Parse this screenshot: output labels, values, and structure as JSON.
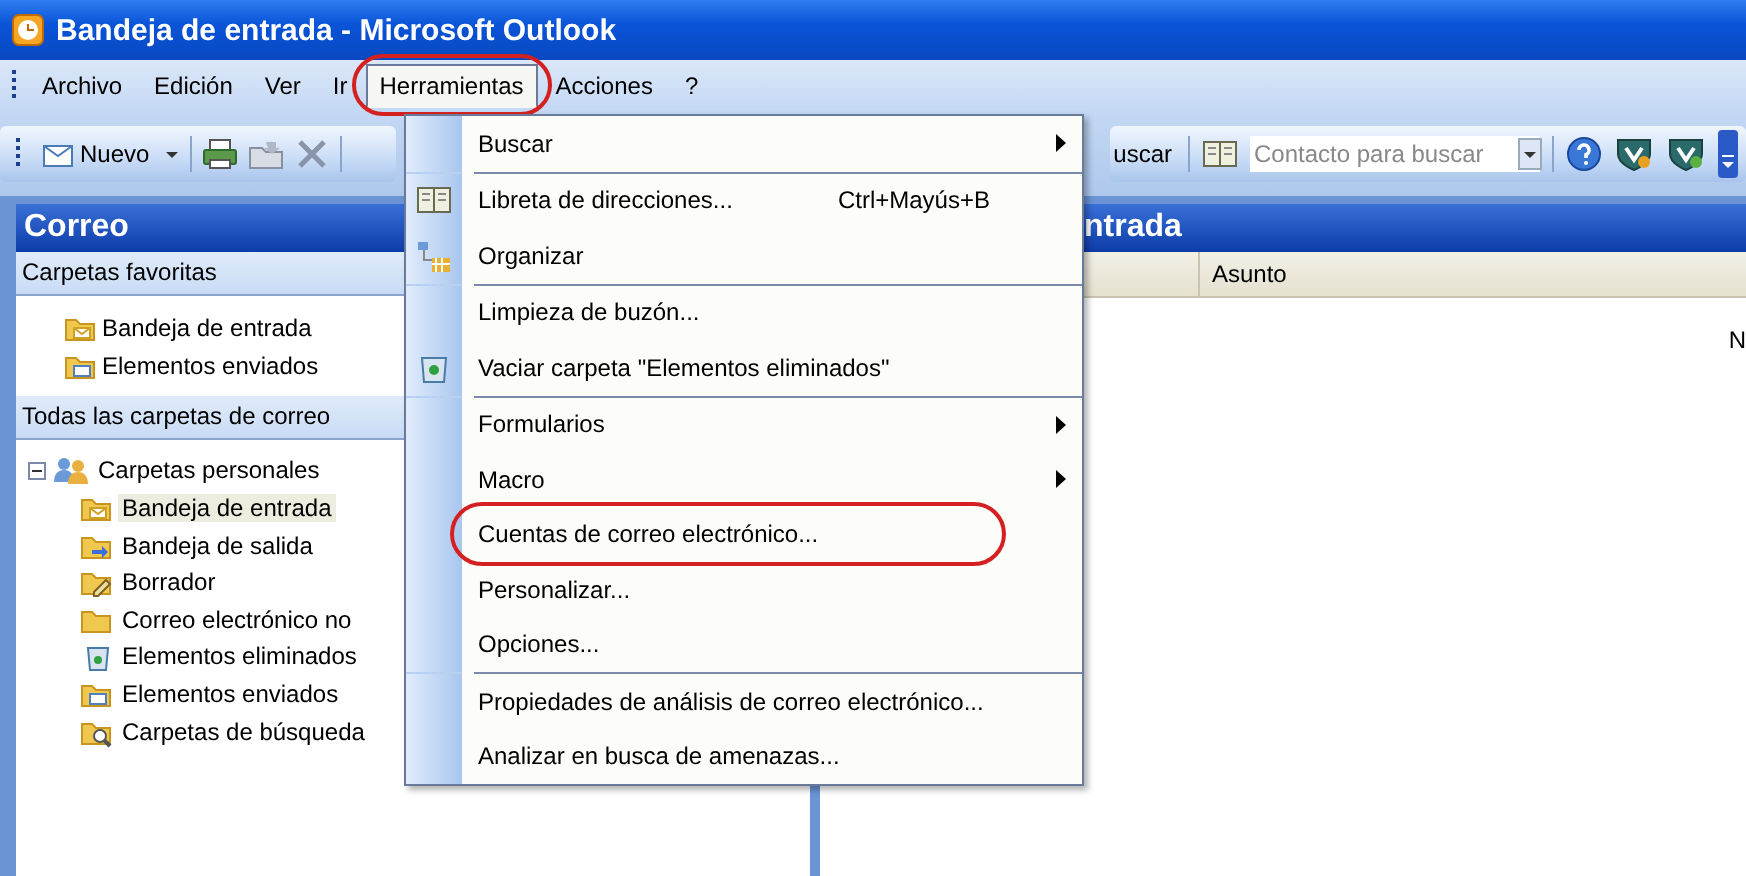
{
  "window": {
    "title": "Bandeja de entrada - Microsoft Outlook"
  },
  "menu_bar": [
    {
      "label": "Archivo",
      "selected": false,
      "circled": false
    },
    {
      "label": "Edición",
      "selected": false,
      "circled": false
    },
    {
      "label": "Ver",
      "selected": false,
      "circled": false
    },
    {
      "label": "Ir",
      "selected": false,
      "circled": false
    },
    {
      "label": "Herramientas",
      "selected": true,
      "circled": true
    },
    {
      "label": "Acciones",
      "selected": false,
      "circled": false
    },
    {
      "label": "?",
      "selected": false,
      "circled": false
    }
  ],
  "toolbar": {
    "new_button": "Nuevo",
    "search_button": "uscar",
    "contact_search": {
      "placeholder": "Contacto para buscar"
    }
  },
  "navigation_pane": {
    "title": "Correo",
    "favorites": {
      "title": "Carpetas favoritas",
      "items": [
        {
          "label": "Bandeja de entrada",
          "selected": false
        },
        {
          "label": "Elementos enviados",
          "selected": false
        }
      ]
    },
    "all_folders": {
      "title": "Todas las carpetas de correo",
      "tree": [
        {
          "label": "Carpetas personales",
          "expanded": true,
          "selected": false,
          "children": [
            {
              "label": "Bandeja de entrada",
              "selected": true
            },
            {
              "label": "Bandeja de salida",
              "selected": false
            },
            {
              "label": "Borrador",
              "selected": false
            },
            {
              "label": "Correo electrónico no",
              "selected": false
            },
            {
              "label": "Elementos eliminados",
              "selected": false
            },
            {
              "label": "Elementos enviados",
              "selected": false
            },
            {
              "label": "Carpetas de búsqueda",
              "selected": false
            }
          ]
        }
      ]
    }
  },
  "message_list": {
    "title": "ntrada",
    "columns": [
      {
        "label": "Asunto"
      }
    ],
    "empty_text": "N"
  },
  "tools_menu": {
    "items": [
      {
        "kind": "item",
        "label": "Buscar",
        "submenu": true,
        "circled": false
      },
      {
        "kind": "separator"
      },
      {
        "kind": "item",
        "label": "Libreta de direcciones...",
        "shortcut": "Ctrl+Mayús+B",
        "submenu": false,
        "circled": false
      },
      {
        "kind": "item",
        "label": "Organizar",
        "submenu": false,
        "circled": false
      },
      {
        "kind": "separator"
      },
      {
        "kind": "item",
        "label": "Limpieza de buzón...",
        "submenu": false,
        "circled": false
      },
      {
        "kind": "item",
        "label": "Vaciar carpeta \"Elementos eliminados\"",
        "submenu": false,
        "circled": false
      },
      {
        "kind": "separator"
      },
      {
        "kind": "item",
        "label": "Formularios",
        "submenu": true,
        "circled": false
      },
      {
        "kind": "item",
        "label": "Macro",
        "submenu": true,
        "circled": false
      },
      {
        "kind": "item",
        "label": "Cuentas de correo electrónico...",
        "submenu": false,
        "circled": true
      },
      {
        "kind": "item",
        "label": "Personalizar...",
        "submenu": false,
        "circled": false
      },
      {
        "kind": "item",
        "label": "Opciones...",
        "submenu": false,
        "circled": false
      },
      {
        "kind": "separator"
      },
      {
        "kind": "item",
        "label": "Propiedades de análisis de correo electrónico...",
        "submenu": false,
        "circled": false
      },
      {
        "kind": "item",
        "label": "Analizar en busca de amenazas...",
        "submenu": false,
        "circled": false
      }
    ]
  }
}
